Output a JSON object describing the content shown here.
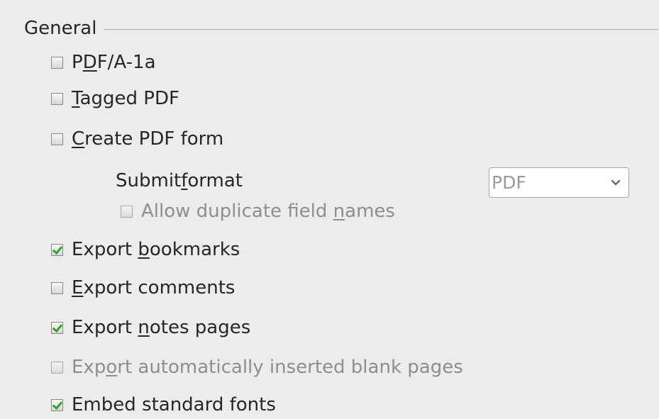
{
  "section": {
    "title": "General"
  },
  "options": {
    "pdfa": {
      "pre": "P",
      "ul": "D",
      "post": "F/A-1a",
      "checked": false,
      "enabled": true
    },
    "tagged": {
      "pre": "",
      "ul": "T",
      "post": "agged PDF",
      "checked": false,
      "enabled": true
    },
    "create_form": {
      "pre": "",
      "ul": "C",
      "post": "reate PDF form",
      "checked": false,
      "enabled": true
    },
    "allow_dup": {
      "pre": "Allow duplicate field ",
      "ul": "n",
      "post": "ames",
      "checked": false,
      "enabled": false
    },
    "bookmarks": {
      "pre": "Export ",
      "ul": "b",
      "post": "ookmarks",
      "checked": true,
      "enabled": true
    },
    "comments": {
      "pre": "",
      "ul": "E",
      "post": "xport comments",
      "checked": false,
      "enabled": true
    },
    "notes": {
      "pre": "Export ",
      "ul": "n",
      "post": "otes pages",
      "checked": true,
      "enabled": true
    },
    "blank_pages": {
      "pre": "Exp",
      "ul": "o",
      "post": "rt automatically inserted blank pages",
      "checked": false,
      "enabled": false
    },
    "embed_fonts": {
      "pre": "Embed standard fonts",
      "ul": "",
      "post": "",
      "checked": true,
      "enabled": true
    }
  },
  "submit_format": {
    "label_pre": "Submit ",
    "label_ul": "f",
    "label_post": "ormat",
    "value": "PDF",
    "enabled": false
  },
  "colors": {
    "check": "#33a12b",
    "disabled_text": "#8f8e8b",
    "background": "#edeceb"
  }
}
